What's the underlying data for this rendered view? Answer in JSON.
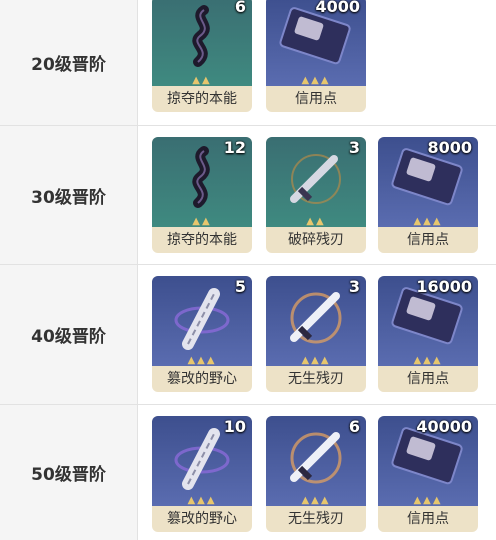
{
  "rows": [
    {
      "label": "20级晋阶",
      "items": [
        {
          "name": "掠夺的本能",
          "qty": "6",
          "icon": "dark-ribbon-icon"
        },
        {
          "name": "信用点",
          "qty": "4000",
          "icon": "credit-card-icon"
        }
      ]
    },
    {
      "label": "30级晋阶",
      "items": [
        {
          "name": "掠夺的本能",
          "qty": "12",
          "icon": "dark-ribbon-icon"
        },
        {
          "name": "破碎残刃",
          "qty": "3",
          "icon": "broken-blade-icon"
        },
        {
          "name": "信用点",
          "qty": "8000",
          "icon": "credit-card-icon"
        }
      ]
    },
    {
      "label": "40级晋阶",
      "items": [
        {
          "name": "篡改的野心",
          "qty": "5",
          "icon": "silver-ribbon-icon"
        },
        {
          "name": "无生残刃",
          "qty": "3",
          "icon": "lifeless-blade-icon"
        },
        {
          "name": "信用点",
          "qty": "16000",
          "icon": "credit-card-icon"
        }
      ]
    },
    {
      "label": "50级晋阶",
      "items": [
        {
          "name": "篡改的野心",
          "qty": "10",
          "icon": "silver-ribbon-icon"
        },
        {
          "name": "无生残刃",
          "qty": "6",
          "icon": "lifeless-blade-icon"
        },
        {
          "name": "信用点",
          "qty": "40000",
          "icon": "credit-card-icon"
        }
      ]
    }
  ],
  "colors": {
    "star": "#e7c66d",
    "teal": "#3f8a80",
    "blue": "#5a6cb0",
    "name_bg": "#ede2c7"
  }
}
